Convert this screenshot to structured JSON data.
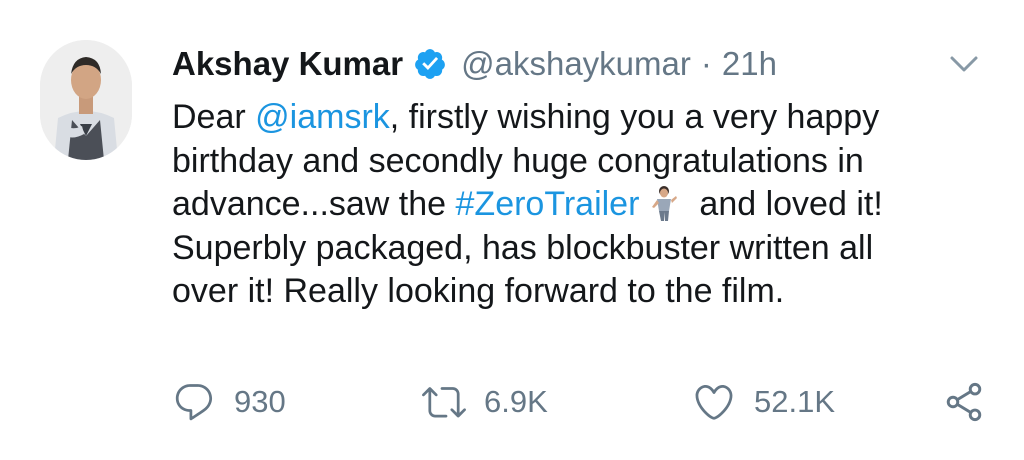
{
  "author": {
    "name": "Akshay Kumar",
    "handle": "@akshaykumar",
    "separator": "·",
    "time": "21h"
  },
  "tweet": {
    "line1_prefix": "Dear ",
    "line1_mention": "@iamsrk",
    "line1_suffix": ", firstly wishing you a very happy",
    "line2": "birthday and secondly huge congratulations in",
    "line3_prefix": "advance...saw the ",
    "line3_hashtag": "#ZeroTrailer",
    "line3_suffix": "and loved it!",
    "line4": "Superbly packaged, has blockbuster written all",
    "line5": "over it! Really looking forward to the film."
  },
  "actions": {
    "replies": "930",
    "retweets": "6.9K",
    "likes": "52.1K"
  },
  "colors": {
    "link": "#1b95e0",
    "muted": "#657786",
    "text": "#14171a",
    "verified": "#1da1f2"
  },
  "icons": [
    "verified-badge-icon",
    "chevron-down-icon",
    "reply-icon",
    "retweet-icon",
    "like-icon",
    "share-icon"
  ]
}
